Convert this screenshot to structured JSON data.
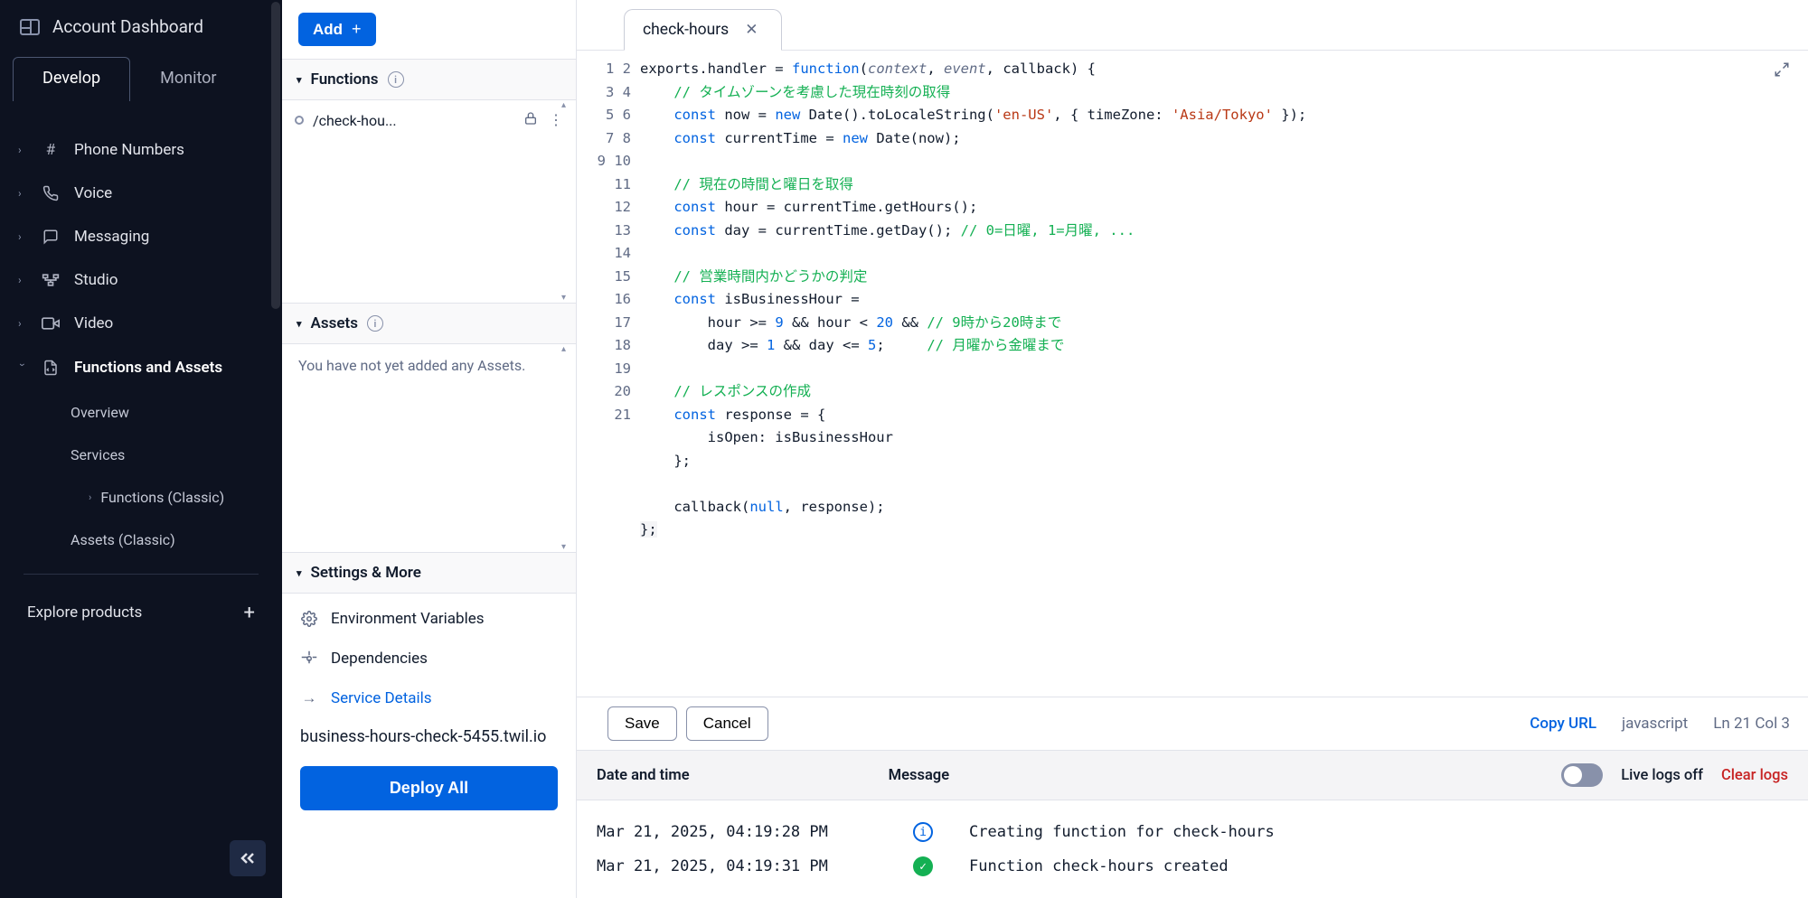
{
  "sidebar": {
    "title": "Account Dashboard",
    "tabs": {
      "develop": "Develop",
      "monitor": "Monitor"
    },
    "nav": {
      "phone": "Phone Numbers",
      "voice": "Voice",
      "messaging": "Messaging",
      "studio": "Studio",
      "video": "Video",
      "functions": "Functions and Assets",
      "overview": "Overview",
      "services": "Services",
      "functions_classic": "Functions (Classic)",
      "assets_classic": "Assets (Classic)"
    },
    "explore": "Explore products"
  },
  "panel": {
    "add": "Add",
    "functions_header": "Functions",
    "assets_header": "Assets",
    "settings_header": "Settings & More",
    "function_name": "/check-hou...",
    "assets_empty": "You have not yet added any Assets.",
    "env_vars": "Environment Variables",
    "dependencies": "Dependencies",
    "service_details": "Service Details",
    "domain": "business-hours-check-5455.twil.io",
    "deploy": "Deploy All"
  },
  "editor": {
    "tab_name": "check-hours",
    "save": "Save",
    "cancel": "Cancel",
    "copy_url": "Copy URL",
    "lang": "javascript",
    "position": "Ln 21  Col 3",
    "line_count": 21
  },
  "logs": {
    "col_datetime": "Date and time",
    "col_message": "Message",
    "live_label": "Live logs off",
    "clear": "Clear logs",
    "rows": [
      {
        "time": "Mar 21, 2025, 04:19:28 PM",
        "type": "info",
        "msg": "Creating function for check-hours"
      },
      {
        "time": "Mar 21, 2025, 04:19:31 PM",
        "type": "success",
        "msg": "Function check-hours created"
      }
    ]
  }
}
